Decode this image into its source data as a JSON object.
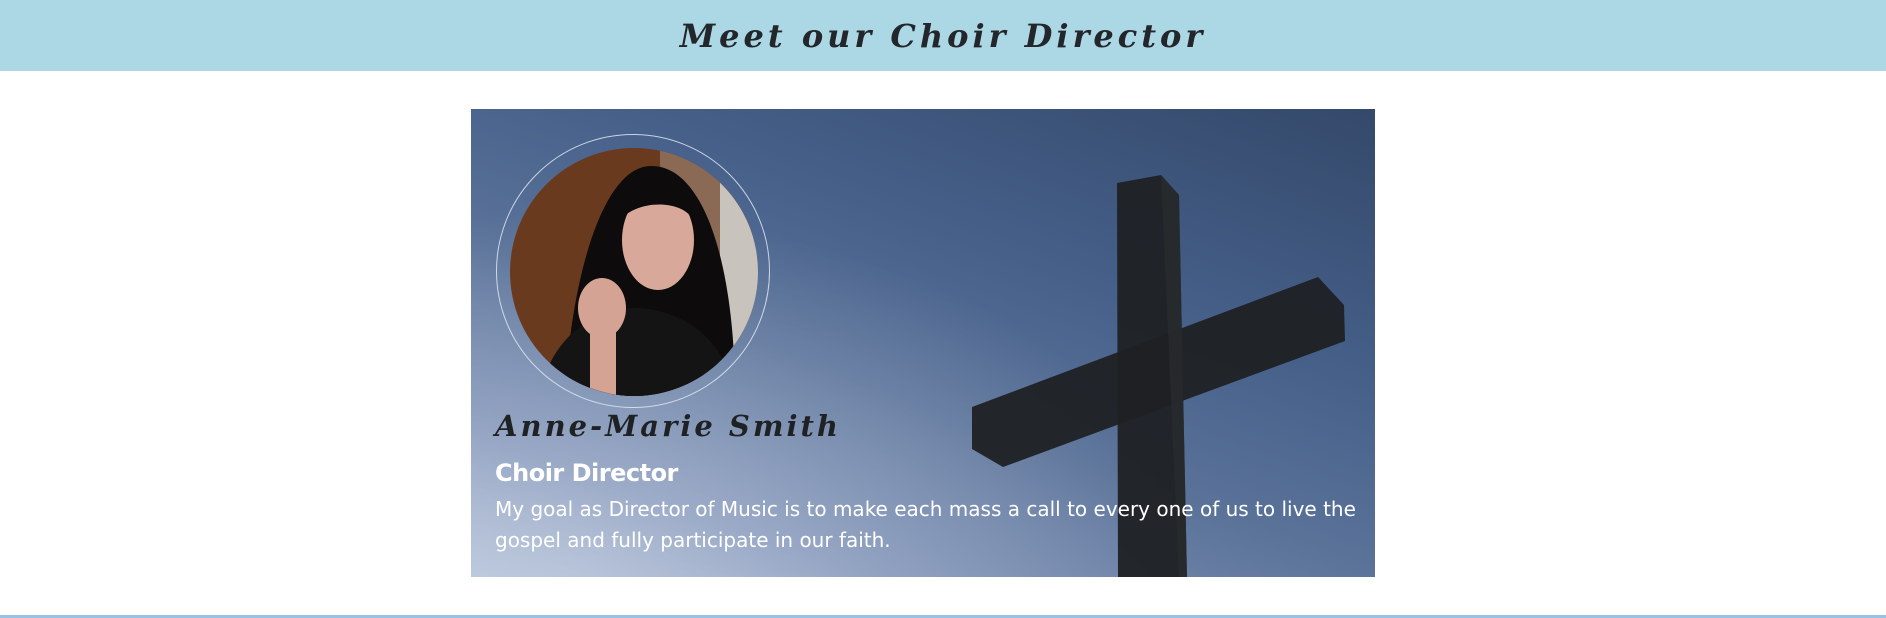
{
  "header": {
    "title": "Meet our Choir Director"
  },
  "director": {
    "name": "Anne-Marie Smith",
    "role": "Choir Director",
    "bio": "My goal as Director of Music is to make each mass a call to every one of us to live the gospel and fully participate in our faith."
  },
  "colors": {
    "header_bg": "#acd8e6",
    "card_bg_dark": "#34496a",
    "card_bg_light": "#b3c1d6",
    "footer_rule": "#98c2e6",
    "cross": "#1f2124"
  }
}
